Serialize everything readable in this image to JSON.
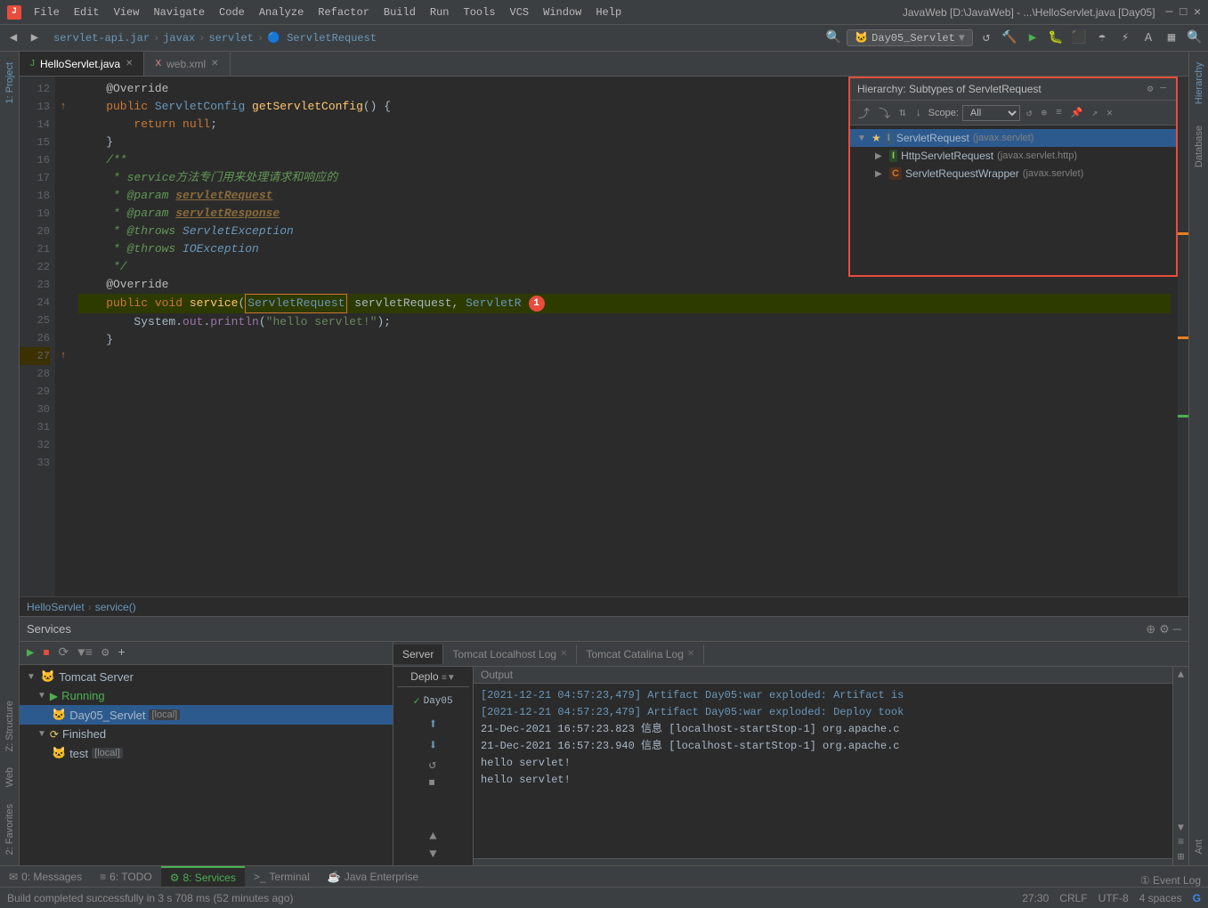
{
  "titlebar": {
    "app_icon": "J",
    "menus": [
      "File",
      "Edit",
      "View",
      "Navigate",
      "Code",
      "Analyze",
      "Refactor",
      "Build",
      "Run",
      "Tools",
      "VCS",
      "Window",
      "Help"
    ],
    "title": "JavaWeb [D:\\JavaWeb] - ...\\HelloServlet.java [Day05]"
  },
  "breadcrumb": {
    "items": [
      "servlet-api.jar",
      "javax",
      "servlet",
      "ServletRequest"
    ]
  },
  "run_config": {
    "label": "Day05_Servlet",
    "icon": "▶"
  },
  "tabs": [
    {
      "label": "HelloServlet.java",
      "active": true,
      "modified": false
    },
    {
      "label": "web.xml",
      "active": false,
      "modified": false
    }
  ],
  "code": {
    "lines": [
      {
        "num": 12,
        "text": "    @Override",
        "type": "annotation"
      },
      {
        "num": 13,
        "text": "    public ServletConfig getServletConfig() {",
        "type": "code"
      },
      {
        "num": 14,
        "text": "        return null;",
        "type": "code"
      },
      {
        "num": 15,
        "text": "    }",
        "type": "code"
      },
      {
        "num": 16,
        "text": "",
        "type": "code"
      },
      {
        "num": 17,
        "text": "",
        "type": "code"
      },
      {
        "num": 18,
        "text": "    /**",
        "type": "comment"
      },
      {
        "num": 19,
        "text": "     * service方法专门用来处理请求和响应的",
        "type": "comment"
      },
      {
        "num": 20,
        "text": "     * @param servletRequest",
        "type": "comment"
      },
      {
        "num": 21,
        "text": "     * @param servletResponse",
        "type": "comment"
      },
      {
        "num": 22,
        "text": "     * @throws ServletException",
        "type": "comment"
      },
      {
        "num": 23,
        "text": "     * @throws IOException",
        "type": "comment"
      },
      {
        "num": 24,
        "text": "     */",
        "type": "comment"
      },
      {
        "num": 25,
        "text": "",
        "type": "code"
      },
      {
        "num": 26,
        "text": "    @Override",
        "type": "annotation"
      },
      {
        "num": 27,
        "text": "    public void service(ServletRequest servletRequest, ServletR",
        "type": "code",
        "highlight": true
      },
      {
        "num": 28,
        "text": "        System.out.println(\"hello servlet!\");",
        "type": "code"
      },
      {
        "num": 29,
        "text": "",
        "type": "code"
      },
      {
        "num": 30,
        "text": "",
        "type": "code"
      },
      {
        "num": 31,
        "text": "",
        "type": "code"
      },
      {
        "num": 32,
        "text": "    }",
        "type": "code"
      },
      {
        "num": 33,
        "text": "",
        "type": "code"
      }
    ]
  },
  "hierarchy": {
    "title": "Hierarchy: Subtypes of ServletRequest",
    "scope_label": "Scope:",
    "scope_value": "All",
    "tree": [
      {
        "level": 0,
        "icon": "I",
        "name": "ServletRequest",
        "pkg": "(javax.servlet)",
        "selected": true,
        "star": true,
        "expanded": true
      },
      {
        "level": 1,
        "icon": "I2",
        "name": "HttpServletRequest",
        "pkg": "(javax.servlet.http)",
        "selected": false,
        "expanded": false
      },
      {
        "level": 1,
        "icon": "C",
        "name": "ServletRequestWrapper",
        "pkg": "(javax.servlet)",
        "selected": false,
        "expanded": false
      }
    ]
  },
  "breadcrumb_strip": {
    "items": [
      "HelloServlet",
      "service()"
    ]
  },
  "bottom": {
    "title": "Services",
    "services_tree": [
      {
        "level": 0,
        "label": "Tomcat Server",
        "icon": "server",
        "expanded": true
      },
      {
        "level": 1,
        "label": "Running",
        "icon": "play",
        "expanded": true,
        "status": "running"
      },
      {
        "level": 2,
        "label": "Day05_Servlet",
        "badge": "[local]",
        "selected": true
      },
      {
        "level": 1,
        "label": "Finished",
        "icon": "finish",
        "expanded": true,
        "status": "finished"
      },
      {
        "level": 2,
        "label": "test",
        "badge": "[local]"
      }
    ],
    "output_tabs": [
      {
        "label": "Server",
        "active": true
      },
      {
        "label": "Tomcat Localhost Log",
        "active": false
      },
      {
        "label": "Tomcat Catalina Log",
        "active": false
      }
    ],
    "deploy_label": "Deplo",
    "output_label": "Output",
    "output_lines": [
      {
        "text": "[2021-12-21 04:57:23,479] Artifact Day05:war exploded: Artifact is",
        "color": "blue"
      },
      {
        "text": "[2021-12-21 04:57:23,479] Artifact Day05:war exploded: Deploy took",
        "color": "blue"
      },
      {
        "text": "21-Dec-2021 16:57:23.823 信息 [localhost-startStop-1] org.apache.c",
        "color": "normal"
      },
      {
        "text": "21-Dec-2021 16:57:23.940 信息 [localhost-startStop-1] org.apache.c",
        "color": "normal"
      },
      {
        "text": "hello servlet!",
        "color": "normal"
      },
      {
        "text": "hello servlet!",
        "color": "normal"
      }
    ]
  },
  "status_bar": {
    "build_status": "Build completed successfully in 3 s 708 ms (52 minutes ago)",
    "position": "27:30",
    "line_sep": "CRLF",
    "encoding": "UTF-8",
    "indent": "4 spaces"
  },
  "bottom_tabs": [
    {
      "label": "0: Messages",
      "icon": "✉",
      "active": false
    },
    {
      "label": "6: TODO",
      "icon": "≡",
      "active": false
    },
    {
      "label": "8: Services",
      "icon": "⚙",
      "active": true
    },
    {
      "label": "Terminal",
      "icon": ">_",
      "active": false
    },
    {
      "label": "Java Enterprise",
      "icon": "☕",
      "active": false
    }
  ],
  "right_sidebar_tabs": [
    "Hierarchy",
    "Database",
    "Ant"
  ],
  "left_sidebar_tabs": [
    "1: Project",
    "2: Favorites",
    "Z: Structure",
    "Web"
  ]
}
